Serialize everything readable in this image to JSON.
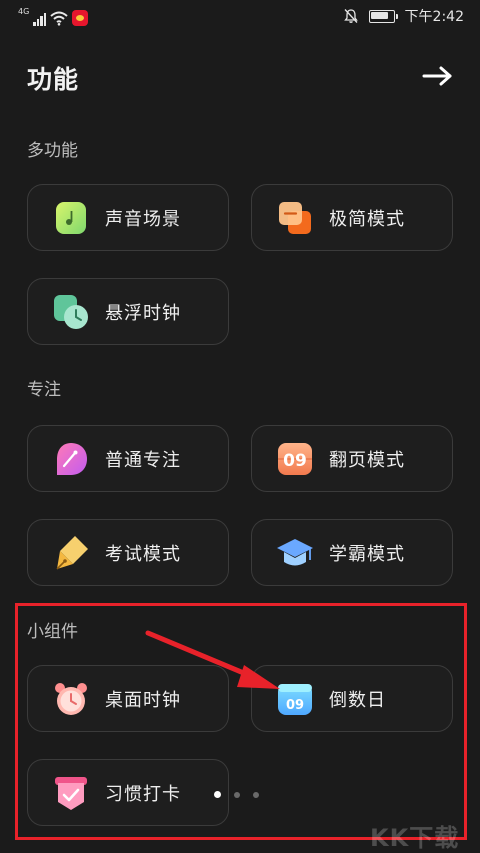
{
  "status_bar": {
    "network": "4G",
    "time": "下午2:42"
  },
  "header": {
    "title": "功能",
    "back_icon": "arrow-right-icon"
  },
  "sections": [
    {
      "label": "多功能",
      "tiles": [
        {
          "label": "声音场景",
          "icon": "sound-scene-icon"
        },
        {
          "label": "极简模式",
          "icon": "minimal-mode-icon"
        },
        {
          "label": "悬浮时钟",
          "icon": "floating-clock-icon"
        }
      ]
    },
    {
      "label": "专注",
      "tiles": [
        {
          "label": "普通专注",
          "icon": "normal-focus-icon"
        },
        {
          "label": "翻页模式",
          "icon": "flip-mode-icon",
          "icon_text": "09"
        },
        {
          "label": "考试模式",
          "icon": "exam-pen-icon"
        },
        {
          "label": "学霸模式",
          "icon": "graduation-cap-icon"
        }
      ]
    },
    {
      "label": "小组件",
      "tiles": [
        {
          "label": "桌面时钟",
          "icon": "alarm-clock-icon"
        },
        {
          "label": "倒数日",
          "icon": "countdown-calendar-icon",
          "icon_text": "09"
        },
        {
          "label": "习惯打卡",
          "icon": "habit-checkin-icon"
        }
      ]
    }
  ],
  "pager": {
    "pages": 3,
    "current": 1
  },
  "annotation": {
    "color": "#e8222a"
  },
  "watermark": "KK下载",
  "colors": {
    "background": "#1b1b1b",
    "tile_border": "#3b3b3b",
    "accent_red": "#e8222a"
  }
}
